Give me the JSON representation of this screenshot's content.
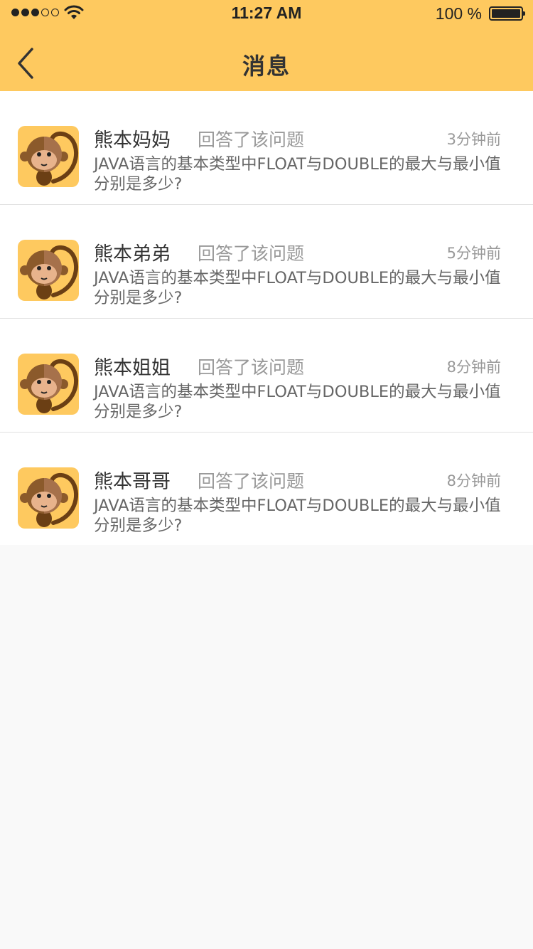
{
  "statusbar": {
    "time": "11:27 AM",
    "battery_text": "100 %",
    "signal_strength": 3,
    "signal_max": 5,
    "battery_level": 1.0
  },
  "navbar": {
    "title": "消息",
    "back_icon": "chevron-left-icon"
  },
  "theme": {
    "accent": "#fec95f",
    "background": "#f9f9f9"
  },
  "messages": [
    {
      "name": "熊本妈妈",
      "action": "回答了该问题",
      "time": "3分钟前",
      "content": "JAVA语言的基本类型中FLOAT与DOUBLE的最大与最小值分别是多少?",
      "avatar_icon": "monkey-avatar-icon"
    },
    {
      "name": "熊本弟弟",
      "action": "回答了该问题",
      "time": "5分钟前",
      "content": "JAVA语言的基本类型中FLOAT与DOUBLE的最大与最小值分别是多少?",
      "avatar_icon": "monkey-avatar-icon"
    },
    {
      "name": "熊本姐姐",
      "action": "回答了该问题",
      "time": "8分钟前",
      "content": "JAVA语言的基本类型中FLOAT与DOUBLE的最大与最小值分别是多少?",
      "avatar_icon": "monkey-avatar-icon"
    },
    {
      "name": "熊本哥哥",
      "action": "回答了该问题",
      "time": "8分钟前",
      "content": "JAVA语言的基本类型中FLOAT与DOUBLE的最大与最小值分别是多少?",
      "avatar_icon": "monkey-avatar-icon"
    }
  ]
}
